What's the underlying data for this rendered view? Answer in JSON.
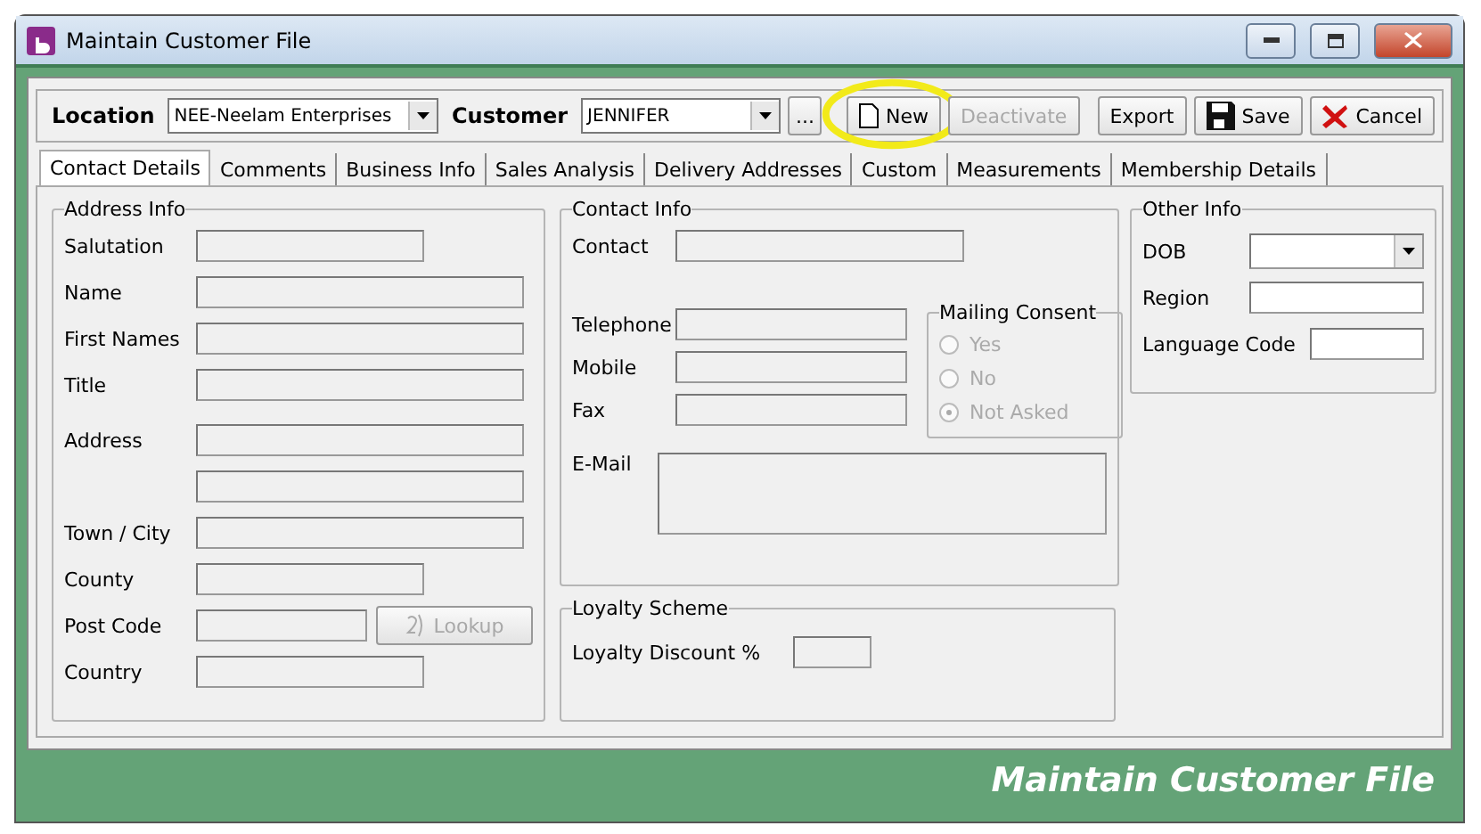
{
  "window": {
    "title": "Maintain Customer File"
  },
  "toolbar": {
    "location_label": "Location",
    "location_value": "NEE-Neelam Enterprises",
    "customer_label": "Customer",
    "customer_value": "JENNIFER",
    "browse_button": "...",
    "buttons": [
      {
        "label": "New",
        "kind": "page",
        "disabled": false,
        "highlighted": true
      },
      {
        "label": "Deactivate",
        "kind": "plain",
        "disabled": true,
        "highlighted": false
      },
      {
        "label": "Export",
        "kind": "plain",
        "disabled": false,
        "highlighted": false
      },
      {
        "label": "Save",
        "kind": "disk",
        "disabled": false,
        "highlighted": false
      },
      {
        "label": "Cancel",
        "kind": "cross",
        "disabled": false,
        "highlighted": false
      }
    ]
  },
  "tabs": [
    {
      "label": "Contact Details",
      "selected": true
    },
    {
      "label": "Comments",
      "selected": false
    },
    {
      "label": "Business Info",
      "selected": false
    },
    {
      "label": "Sales Analysis",
      "selected": false
    },
    {
      "label": "Delivery Addresses",
      "selected": false
    },
    {
      "label": "Custom",
      "selected": false
    },
    {
      "label": "Measurements",
      "selected": false
    },
    {
      "label": "Membership Details",
      "selected": false
    }
  ],
  "address_info": {
    "title": "Address Info",
    "fields": [
      {
        "label": "Salutation",
        "kind": "medium",
        "disabled": true
      },
      {
        "label": "Name",
        "kind": "long",
        "disabled": true
      },
      {
        "label": "First Names",
        "kind": "long",
        "disabled": true
      },
      {
        "label": "Title",
        "kind": "long",
        "disabled": true
      },
      {
        "label": "Address",
        "kind": "long",
        "disabled": true
      },
      {
        "kind": "long",
        "disabled": true
      },
      {
        "label": "Town / City",
        "kind": "long",
        "disabled": true
      },
      {
        "label": "County",
        "kind": "medium",
        "disabled": true
      },
      {
        "label": "Post Code",
        "kind": "postcode",
        "disabled": true,
        "button": "Lookup"
      },
      {
        "label": "Country",
        "kind": "medium",
        "disabled": true
      }
    ]
  },
  "contact_info": {
    "title": "Contact Info",
    "contact": {
      "label": "Contact",
      "disabled": true
    },
    "phones": [
      {
        "label": "Telephone",
        "disabled": true
      },
      {
        "label": "Mobile",
        "disabled": true
      },
      {
        "label": "Fax",
        "disabled": true
      }
    ],
    "mailing_consent": {
      "title": "Mailing Consent",
      "disabled": true,
      "options": [
        {
          "label": "Yes",
          "selected": false
        },
        {
          "label": "No",
          "selected": false
        },
        {
          "label": "Not Asked",
          "selected": true
        }
      ]
    },
    "email": {
      "label": "E-Mail",
      "disabled": true
    }
  },
  "loyalty_scheme": {
    "title": "Loyalty Scheme",
    "field": {
      "label": "Loyalty Discount %",
      "disabled": true
    }
  },
  "other_info": {
    "title": "Other Info",
    "fields": [
      {
        "label": "DOB",
        "kind": "dropdown",
        "disabled": false
      },
      {
        "label": "Region",
        "kind": "text",
        "disabled": false
      },
      {
        "label": "Language Code",
        "kind": "text",
        "disabled": false
      }
    ]
  },
  "footer": {
    "title": "Maintain Customer File"
  }
}
